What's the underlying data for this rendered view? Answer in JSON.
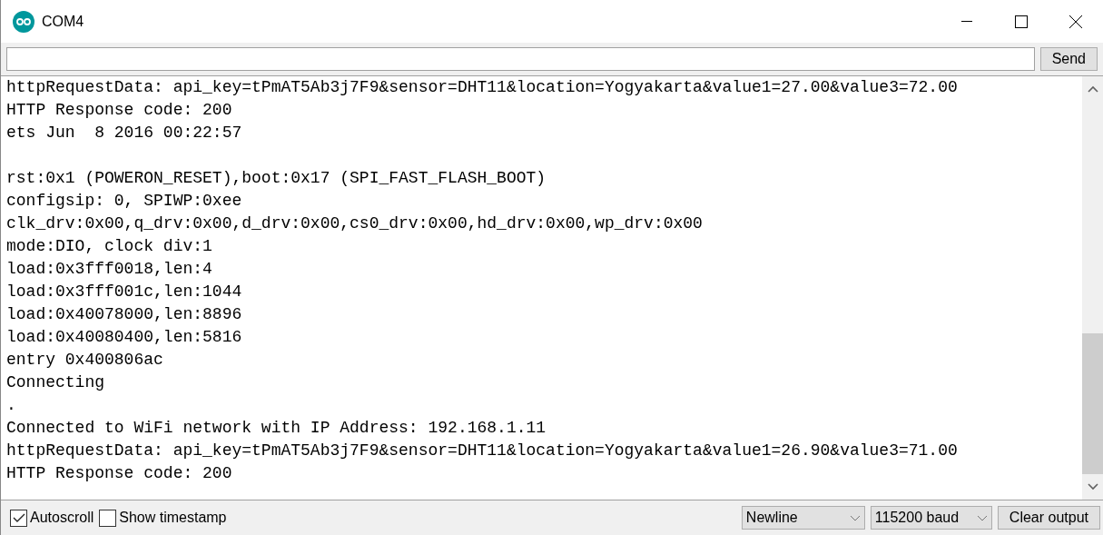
{
  "window": {
    "title": "COM4"
  },
  "send_button": "Send",
  "output_blocks": [
    [
      "httpRequestData: api_key=tPmAT5Ab3j7F9&sensor=DHT11&location=Yogyakarta&value1=27.00&value3=72.00",
      "HTTP Response code: 200",
      "ets Jun  8 2016 00:22:57"
    ],
    [
      "rst:0x1 (POWERON_RESET),boot:0x17 (SPI_FAST_FLASH_BOOT)",
      "configsip: 0, SPIWP:0xee",
      "clk_drv:0x00,q_drv:0x00,d_drv:0x00,cs0_drv:0x00,hd_drv:0x00,wp_drv:0x00",
      "mode:DIO, clock div:1",
      "load:0x3fff0018,len:4",
      "load:0x3fff001c,len:1044",
      "load:0x40078000,len:8896",
      "load:0x40080400,len:5816",
      "entry 0x400806ac",
      "Connecting",
      ".",
      "Connected to WiFi network with IP Address: 192.168.1.11",
      "httpRequestData: api_key=tPmAT5Ab3j7F9&sensor=DHT11&location=Yogyakarta&value1=26.90&value3=71.00",
      "HTTP Response code: 200"
    ]
  ],
  "options": [
    {
      "label": "Autoscroll",
      "checked": true
    },
    {
      "label": "Show timestamp",
      "checked": false
    }
  ],
  "line_ending": "Newline",
  "baud_rate": "115200 baud",
  "clear_button": "Clear output"
}
